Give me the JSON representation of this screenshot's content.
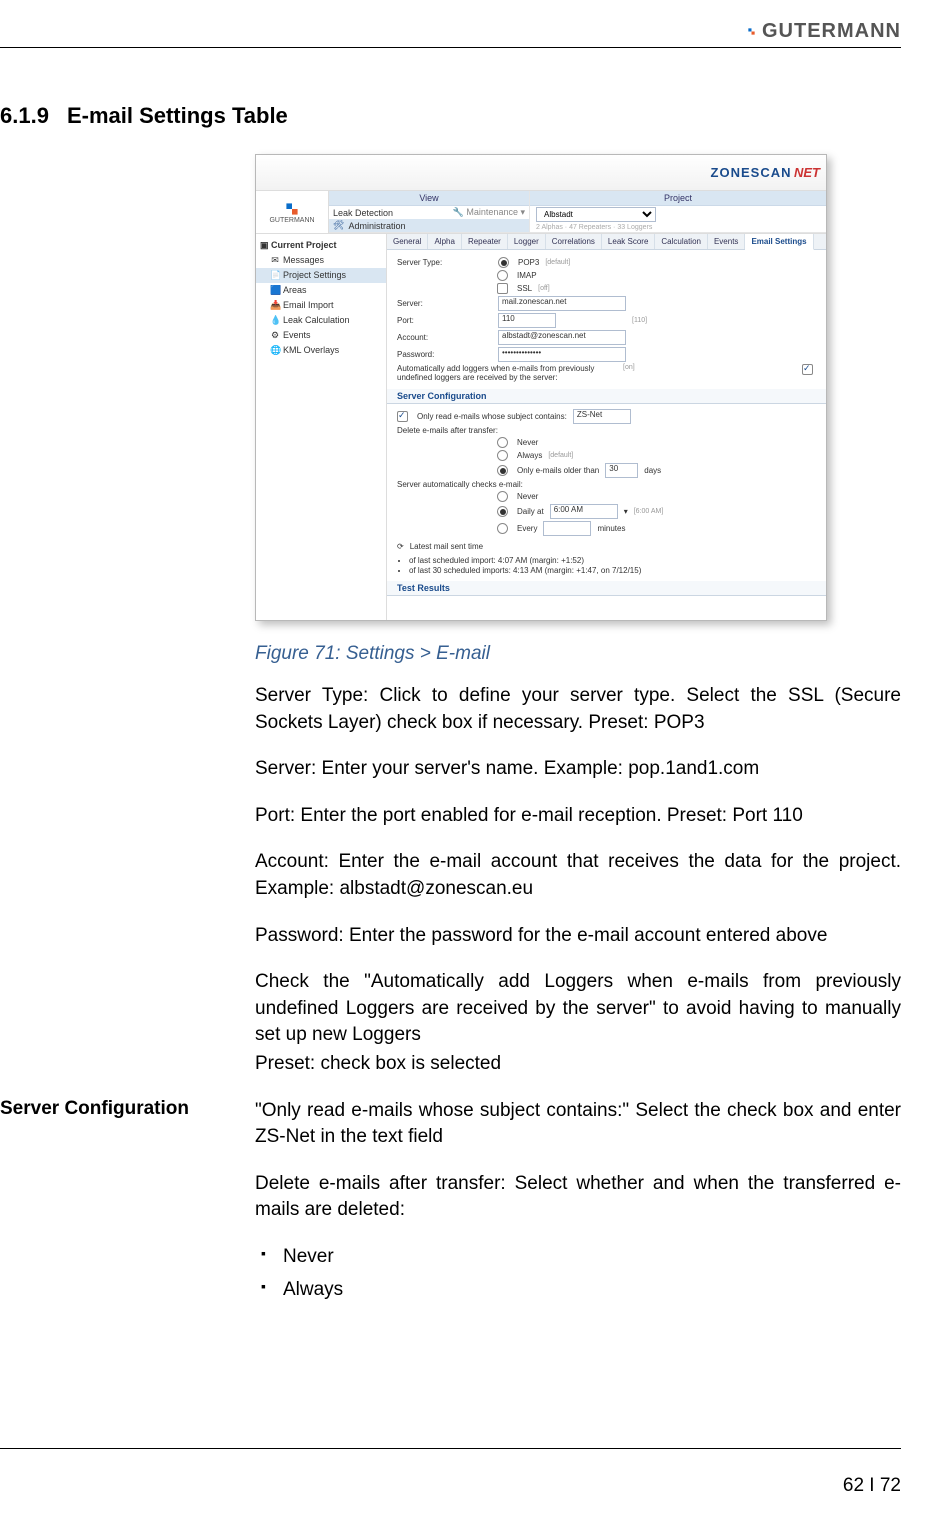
{
  "header": {
    "brand": "GUTERMANN"
  },
  "section": {
    "number": "6.1.9",
    "title": "E-mail Settings Table"
  },
  "figure": {
    "top_brand": "ZONESCAN",
    "top_net": "NET",
    "top_logo": "GUTERMANN",
    "nav": {
      "view_header": "View",
      "project_header": "Project",
      "leak_detection": "Leak Detection",
      "maintenance": "Maintenance",
      "administration": "Administration",
      "project_select": "Albstadt",
      "project_sub": "2 Alphas · 47 Repeaters · 33 Loggers"
    },
    "tree": {
      "root": "Current Project",
      "items": [
        "Messages",
        "Project Settings",
        "Areas",
        "Email Import",
        "Leak Calculation",
        "Events",
        "KML Overlays"
      ]
    },
    "tabs": [
      "General",
      "Alpha",
      "Repeater",
      "Logger",
      "Correlations",
      "Leak Score",
      "Calculation",
      "Events",
      "Email Settings"
    ],
    "active_tab": "Email Settings",
    "form": {
      "server_type_label": "Server Type:",
      "pop3": "POP3",
      "default_hint": "[default]",
      "imap": "IMAP",
      "ssl": "SSL",
      "ssl_hint": "[off]",
      "server_label": "Server:",
      "server_value": "mail.zonescan.net",
      "port_label": "Port:",
      "port_value": "110",
      "port_hint": "[110]",
      "account_label": "Account:",
      "account_value": "albstadt@zonescan.net",
      "password_label": "Password:",
      "password_value": "••••••••••••••",
      "auto_add": "Automatically add loggers when e-mails from previously undefined loggers are received by the server:",
      "auto_hint": "[on]",
      "server_config": "Server Configuration",
      "only_read": "Only read e-mails whose subject contains:",
      "only_read_value": "ZS-Net",
      "delete_label": "Delete e-mails after transfer:",
      "never": "Never",
      "always": "Always",
      "always_hint": "[default]",
      "older": "Only e-mails older than",
      "older_value": "30",
      "older_unit": "days",
      "auto_check": "Server automatically checks e-mail:",
      "check_never": "Never",
      "daily": "Daily at",
      "daily_value": "6:00 AM",
      "daily_hint": "[6:00 AM]",
      "every": "Every",
      "every_unit": "minutes",
      "latest": "Latest mail sent time",
      "b1": "of last scheduled import: 4:07 AM (margin: +1:52)",
      "b2": "of last 30 scheduled imports: 4:13 AM (margin: +1:47, on 7/12/15)",
      "test_results": "Test Results"
    },
    "caption": "Figure 71: Settings > E-mail"
  },
  "paras": {
    "p1": "Server Type: Click to define your server type. Select the SSL (Secure Sockets Layer) check box if necessary. Preset: POP3",
    "p2": "Server: Enter your server's name. Example: pop.1and1.com",
    "p3": "Port: Enter the port enabled for e-mail reception. Preset: Port 110",
    "p4": "Account: Enter the e-mail account that receives the data for the project. Example: albstadt@zonescan.eu",
    "p5": "Password: Enter the password for the e-mail account entered above",
    "p6a": "Check the \"Automatically add Loggers when e-mails from previously undefined Loggers are received by the server\" to avoid having to manually set up new Loggers",
    "p6b": "Preset: check box is selected",
    "side": "Server Configuration",
    "p7": "\"Only read e-mails whose subject contains:\" Select the check box and enter ZS-Net in the text field",
    "p8": "Delete e-mails after transfer: Select whether and when the transferred e-mails are deleted:",
    "b1": "Never",
    "b2": "Always"
  },
  "footer": {
    "page": "62 I 72"
  }
}
